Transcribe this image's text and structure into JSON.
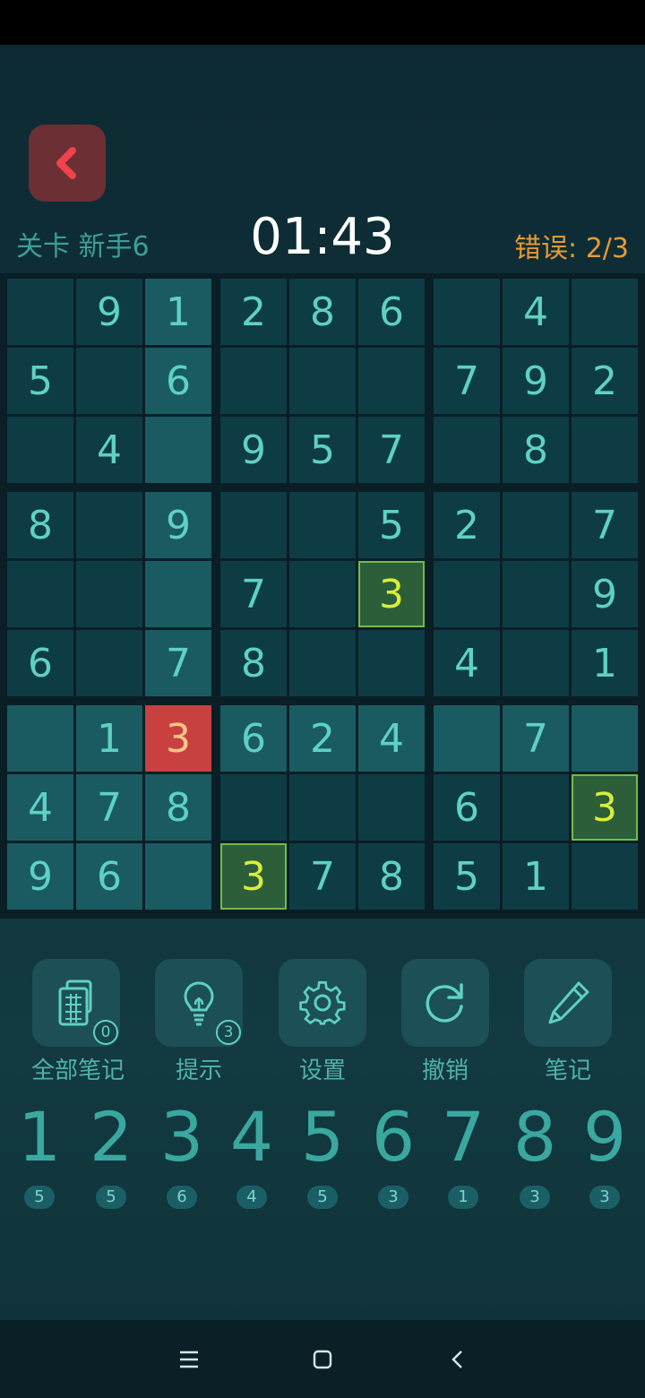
{
  "header": {
    "level_label": "关卡 新手6",
    "timer": "01:43",
    "errors": "错误: 2/3"
  },
  "board": {
    "rows": [
      [
        "",
        "9",
        "1",
        "2",
        "8",
        "6",
        "",
        "4",
        ""
      ],
      [
        "5",
        "",
        "6",
        "",
        "",
        "",
        "7",
        "9",
        "2"
      ],
      [
        "",
        "4",
        "",
        "9",
        "5",
        "7",
        "",
        "8",
        ""
      ],
      [
        "8",
        "",
        "9",
        "",
        "",
        "5",
        "2",
        "",
        "7"
      ],
      [
        "",
        "",
        "",
        "7",
        "",
        "3",
        "",
        "",
        "9"
      ],
      [
        "6",
        "",
        "7",
        "8",
        "",
        "",
        "4",
        "",
        "1"
      ],
      [
        "",
        "1",
        "3",
        "6",
        "2",
        "4",
        "",
        "7",
        ""
      ],
      [
        "4",
        "7",
        "8",
        "",
        "",
        "",
        "6",
        "",
        "3"
      ],
      [
        "9",
        "6",
        "",
        "3",
        "7",
        "8",
        "5",
        "1",
        ""
      ]
    ],
    "error_cells": [
      [
        6,
        2
      ]
    ],
    "correct_cells": [
      [
        4,
        5
      ],
      [
        7,
        8
      ],
      [
        8,
        3
      ]
    ],
    "highlighted_cells": [
      [
        0,
        2
      ],
      [
        1,
        2
      ],
      [
        2,
        2
      ],
      [
        3,
        2
      ],
      [
        4,
        2
      ],
      [
        5,
        2
      ],
      [
        7,
        2
      ],
      [
        8,
        2
      ],
      [
        6,
        0
      ],
      [
        6,
        1
      ],
      [
        6,
        3
      ],
      [
        6,
        4
      ],
      [
        6,
        5
      ],
      [
        6,
        6
      ],
      [
        6,
        7
      ],
      [
        6,
        8
      ],
      [
        7,
        0
      ],
      [
        7,
        1
      ],
      [
        8,
        0
      ],
      [
        8,
        1
      ],
      [
        8,
        2
      ]
    ]
  },
  "tools": [
    {
      "label": "全部笔记",
      "badge": "0",
      "icon": "notes-all-icon"
    },
    {
      "label": "提示",
      "badge": "3",
      "icon": "lightbulb-icon"
    },
    {
      "label": "设置",
      "badge": "",
      "icon": "gear-icon"
    },
    {
      "label": "撤销",
      "badge": "",
      "icon": "undo-icon"
    },
    {
      "label": "笔记",
      "badge": "",
      "icon": "pencil-icon"
    }
  ],
  "numpad": [
    {
      "digit": "1",
      "count": "5"
    },
    {
      "digit": "2",
      "count": "5"
    },
    {
      "digit": "3",
      "count": "6"
    },
    {
      "digit": "4",
      "count": "4"
    },
    {
      "digit": "5",
      "count": "5"
    },
    {
      "digit": "6",
      "count": "3"
    },
    {
      "digit": "7",
      "count": "1"
    },
    {
      "digit": "8",
      "count": "3"
    },
    {
      "digit": "9",
      "count": "3"
    }
  ],
  "colors": {
    "accent": "#5fd1c3",
    "error": "#c84140",
    "correct": "#2c5e3a",
    "errors_text": "#e79a35"
  }
}
